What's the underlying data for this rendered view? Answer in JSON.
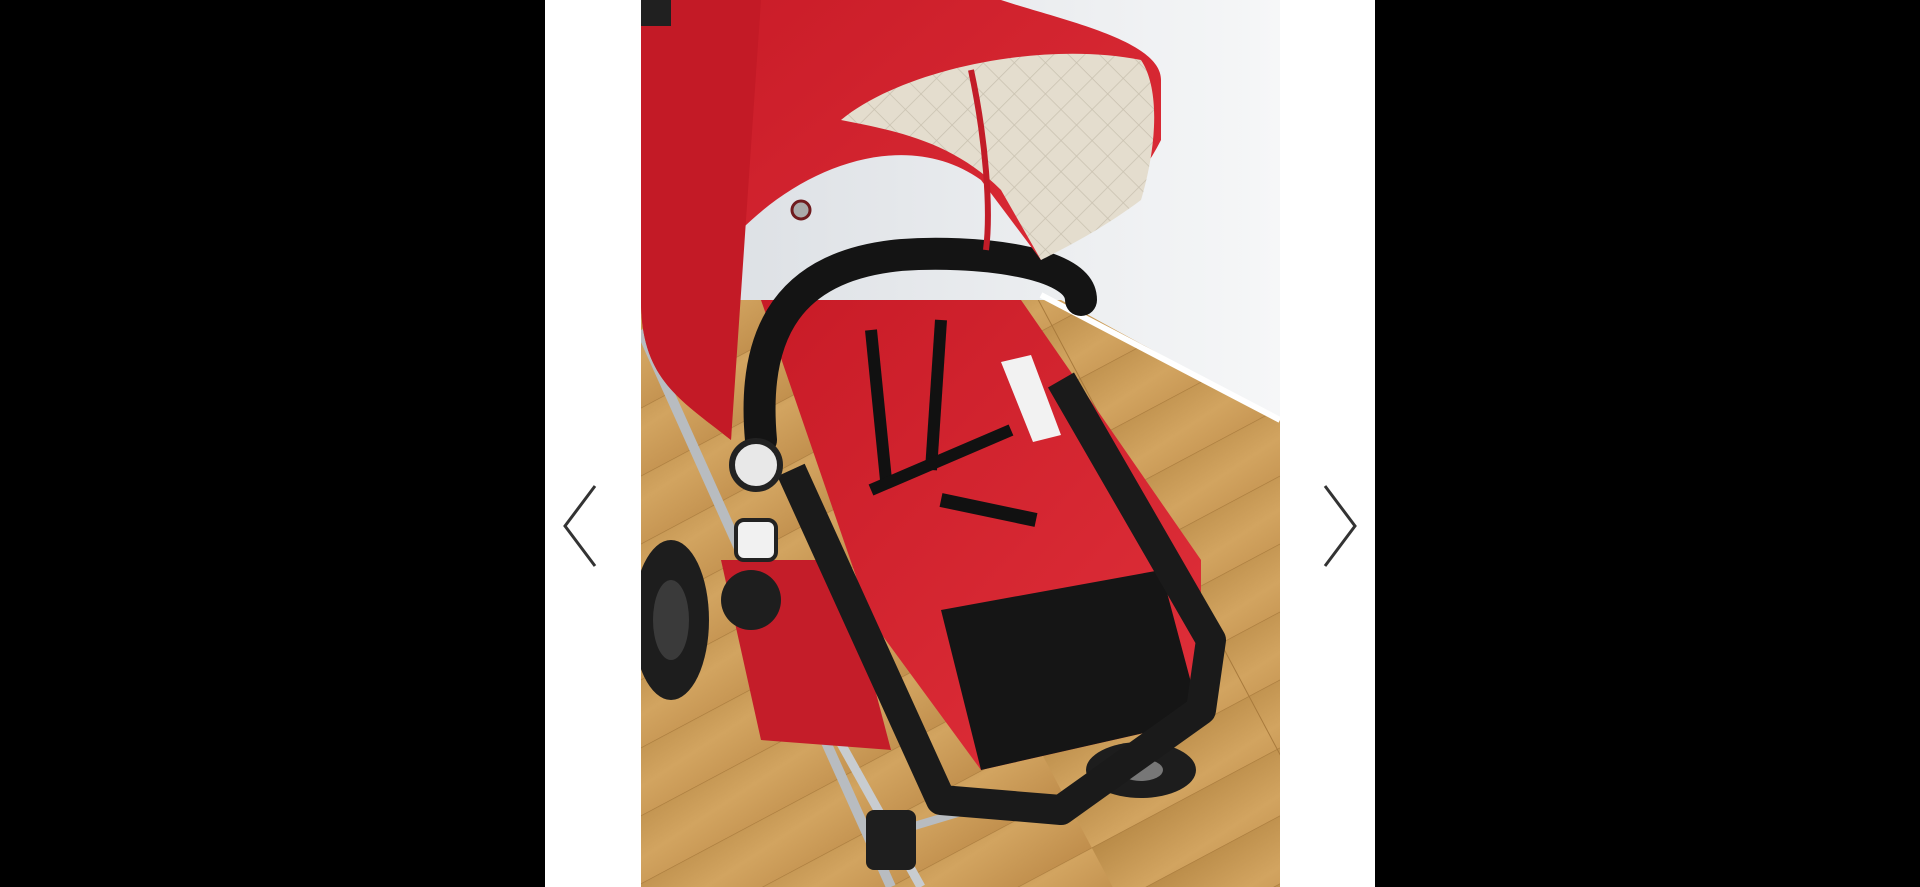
{
  "viewer": {
    "image": {
      "subject": "stroller-photo",
      "colors": {
        "fabric": "#d3202c",
        "canopy_lining": "#e4ddce",
        "frame": "#1c1c1c",
        "floor": "#c9994f",
        "wall": "#eef0f2"
      }
    },
    "prev_button": {
      "icon": "chevron-left-icon"
    },
    "next_button": {
      "icon": "chevron-right-icon"
    },
    "background": "#000000",
    "panel_background": "#ffffff"
  }
}
